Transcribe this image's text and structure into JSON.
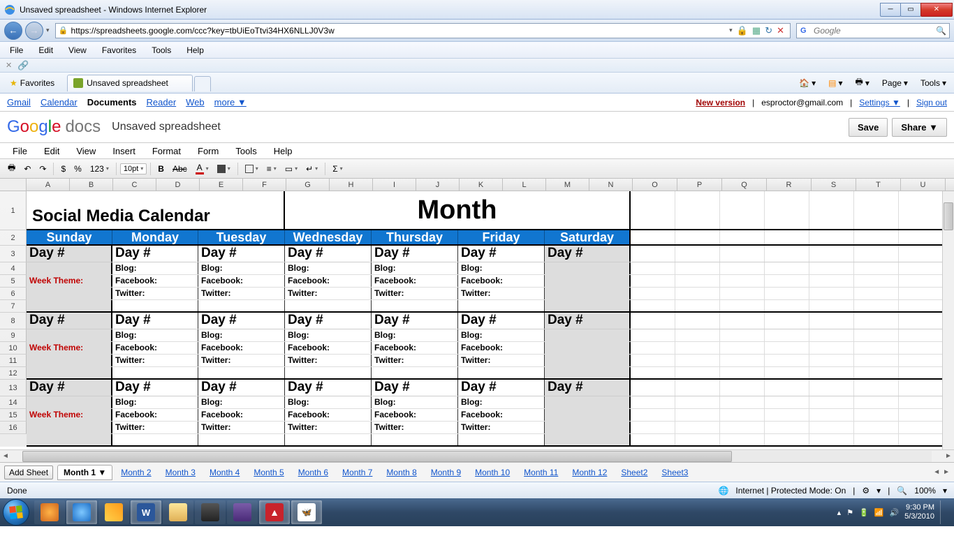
{
  "window": {
    "title": "Unsaved spreadsheet - Windows Internet Explorer"
  },
  "url": "https://spreadsheets.google.com/ccc?key=tbUiEoTtvi34HX6NLLJ0V3w",
  "search_placeholder": "Google",
  "ie_menu": [
    "File",
    "Edit",
    "View",
    "Favorites",
    "Tools",
    "Help"
  ],
  "favorites_label": "Favorites",
  "tab_label": "Unsaved spreadsheet",
  "ie_tools": {
    "page": "Page",
    "tools": "Tools"
  },
  "gbar": {
    "links": [
      "Gmail",
      "Calendar",
      "Documents",
      "Reader",
      "Web",
      "more ▼"
    ],
    "active_index": 2,
    "new_version": "New version",
    "email": "esproctor@gmail.com",
    "settings": "Settings ▼",
    "signout": "Sign out"
  },
  "docs": {
    "logo_suffix": "docs",
    "title": "Unsaved spreadsheet",
    "save": "Save",
    "share": "Share ▼",
    "menu": [
      "File",
      "Edit",
      "View",
      "Insert",
      "Format",
      "Form",
      "Tools",
      "Help"
    ]
  },
  "toolbar": {
    "currency": "$",
    "percent": "%",
    "numfmt": "123",
    "fontsize": "10pt",
    "bold": "B",
    "strike": "Abc",
    "textcolor": "A",
    "sigma": "Σ"
  },
  "cols": [
    "A",
    "B",
    "C",
    "D",
    "E",
    "F",
    "G",
    "H",
    "I",
    "J",
    "K",
    "L",
    "M",
    "N",
    "O",
    "P",
    "Q",
    "R",
    "S",
    "T",
    "U"
  ],
  "rows": [
    "1",
    "2",
    "3",
    "4",
    "5",
    "6",
    "7",
    "8",
    "9",
    "10",
    "11",
    "12",
    "13",
    "14",
    "15",
    "16"
  ],
  "cal": {
    "title": "Social Media Calendar",
    "month": "Month",
    "days": [
      "Sunday",
      "Monday",
      "Tuesday",
      "Wednesday",
      "Thursday",
      "Friday",
      "Saturday"
    ],
    "dayn": "Day #",
    "week_theme": "Week Theme:",
    "blog": "Blog:",
    "facebook": "Facebook:",
    "twitter": "Twitter:"
  },
  "sheets": {
    "add": "Add Sheet",
    "tabs": [
      "Month 1 ▼",
      "Month 2",
      "Month 3",
      "Month 4",
      "Month 5",
      "Month 6",
      "Month 7",
      "Month 8",
      "Month 9",
      "Month 10",
      "Month 11",
      "Month 12",
      "Sheet2",
      "Sheet3"
    ],
    "active_index": 0
  },
  "status": {
    "done": "Done",
    "zone": "Internet | Protected Mode: On",
    "zoom": "100%"
  },
  "tray": {
    "time": "9:30 PM",
    "date": "5/3/2010"
  }
}
